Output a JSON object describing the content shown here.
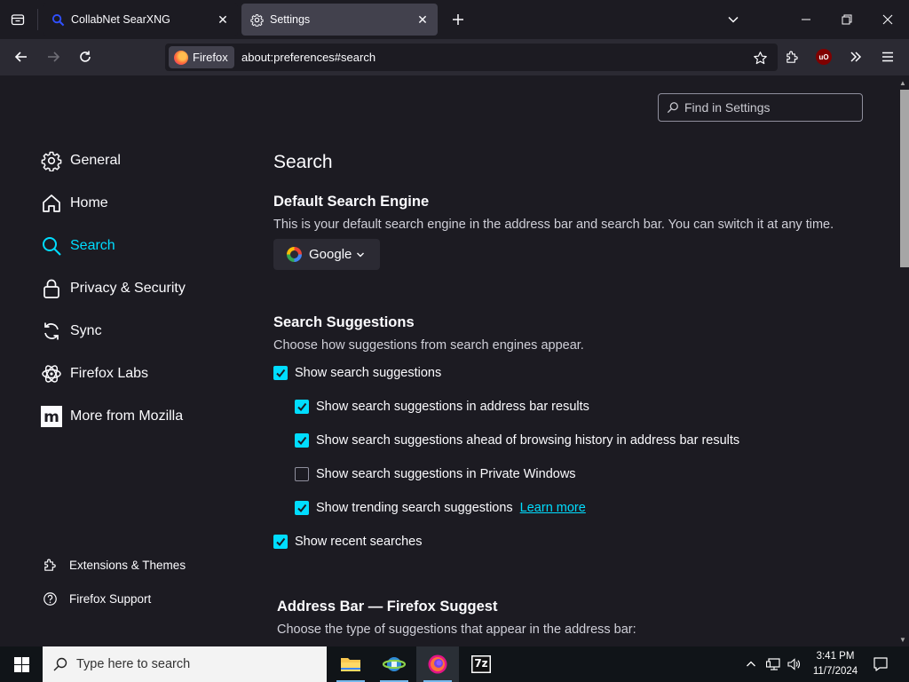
{
  "tabs": [
    {
      "title": "CollabNet SearXNG",
      "active": false
    },
    {
      "title": "Settings",
      "active": true
    }
  ],
  "navbar": {
    "identity_label": "Firefox",
    "url": "about:preferences#search",
    "ublock_label": "uO"
  },
  "find": {
    "placeholder": "Find in Settings"
  },
  "sidebar": {
    "items": [
      {
        "label": "General",
        "icon": "gear-icon"
      },
      {
        "label": "Home",
        "icon": "home-icon"
      },
      {
        "label": "Search",
        "icon": "search-icon",
        "selected": true
      },
      {
        "label": "Privacy & Security",
        "icon": "lock-icon"
      },
      {
        "label": "Sync",
        "icon": "sync-icon"
      },
      {
        "label": "Firefox Labs",
        "icon": "flask-icon"
      },
      {
        "label": "More from Mozilla",
        "icon": "mozilla-icon"
      }
    ],
    "footer": [
      {
        "label": "Extensions & Themes",
        "icon": "puzzle-icon"
      },
      {
        "label": "Firefox Support",
        "icon": "help-icon"
      }
    ]
  },
  "main": {
    "title": "Search",
    "default_engine": {
      "heading": "Default Search Engine",
      "description": "This is your default search engine in the address bar and search bar. You can switch it at any time.",
      "selected": "Google"
    },
    "suggestions": {
      "heading": "Search Suggestions",
      "description": "Choose how suggestions from search engines appear.",
      "options": [
        {
          "label": "Show search suggestions",
          "checked": true
        },
        {
          "label": "Show search suggestions in address bar results",
          "checked": true
        },
        {
          "label": "Show search suggestions ahead of browsing history in address bar results",
          "checked": true
        },
        {
          "label": "Show search suggestions in Private Windows",
          "checked": false
        },
        {
          "label": "Show trending search suggestions",
          "checked": true
        },
        {
          "label": "Show recent searches",
          "checked": true
        }
      ],
      "learn_more": "Learn more"
    },
    "address_bar": {
      "heading": "Address Bar — Firefox Suggest",
      "description": "Choose the type of suggestions that appear in the address bar:"
    }
  },
  "taskbar": {
    "search_placeholder": "Type here to search",
    "apps": [
      "file-explorer-icon",
      "network-app-icon",
      "firefox-icon",
      "7zip-icon"
    ],
    "seven_zip_label": "7z",
    "time": "3:41 PM",
    "date": "11/7/2024"
  },
  "colors": {
    "accent": "#00ddff",
    "background": "#1c1b22",
    "toolbar": "#2b2a33",
    "active_tab": "#42414d"
  }
}
